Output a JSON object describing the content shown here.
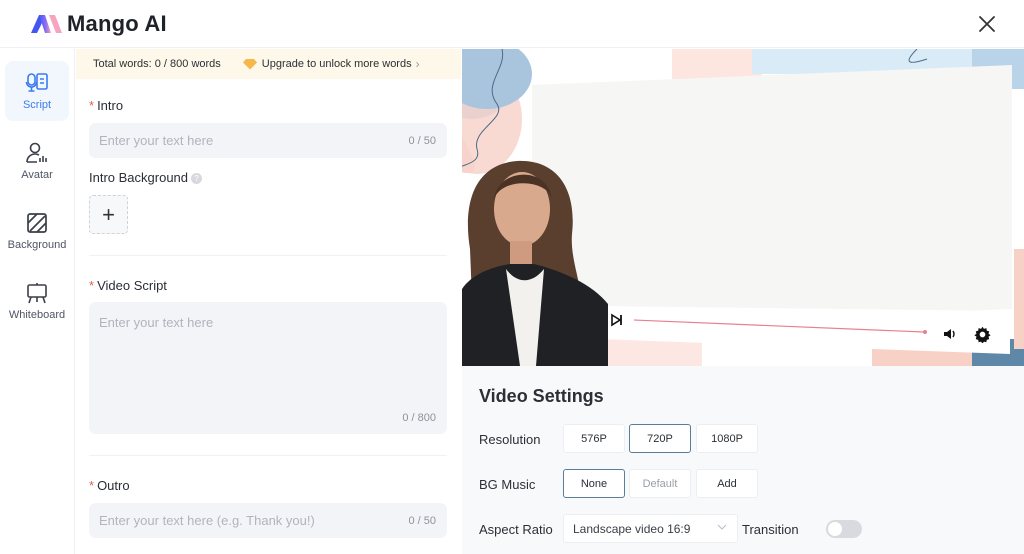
{
  "app": {
    "name": "Mango AI",
    "brand_colors": {
      "logo_left": "#4a5cf5",
      "logo_right": "#f07aa8",
      "accent": "#3c7cf0"
    }
  },
  "header": {
    "close_icon": "close-icon"
  },
  "sidebar": {
    "items": [
      {
        "label": "Script",
        "icon": "script-mic-icon",
        "active": true
      },
      {
        "label": "Avatar",
        "icon": "avatar-icon",
        "active": false
      },
      {
        "label": "Background",
        "icon": "background-icon",
        "active": false
      },
      {
        "label": "Whiteboard",
        "icon": "whiteboard-icon",
        "active": false
      }
    ]
  },
  "words_bar": {
    "total": "Total words: 0 / 800 words",
    "upgrade": "Upgrade to unlock more words",
    "upgrade_icon": "diamond-icon"
  },
  "form": {
    "intro": {
      "label": "Intro",
      "required": "*",
      "placeholder": "Enter your text here",
      "counter": "0 / 50"
    },
    "intro_background": {
      "label": "Intro Background",
      "help": "?",
      "add": "+"
    },
    "video_script": {
      "label": "Video Script",
      "required": "*",
      "placeholder": "Enter your text here",
      "counter": "0 / 800"
    },
    "outro": {
      "label": "Outro",
      "required": "*",
      "placeholder": "Enter your text here (e.g. Thank you!)",
      "counter": "0 / 50"
    }
  },
  "preview": {
    "controls": {
      "play": "play-icon",
      "volume": "volume-icon",
      "settings": "gear-icon"
    },
    "progress_color": "#e8808e"
  },
  "video_settings": {
    "title": "Video Settings",
    "resolution": {
      "label": "Resolution",
      "options": [
        "576P",
        "720P",
        "1080P"
      ],
      "selected": "720P"
    },
    "bg_music": {
      "label": "BG Music",
      "options": [
        "None",
        "Default",
        "Add"
      ],
      "selected": "None"
    },
    "aspect_ratio": {
      "label": "Aspect Ratio",
      "value": "Landscape video 16:9"
    },
    "transition": {
      "label": "Transition",
      "enabled": false
    }
  }
}
